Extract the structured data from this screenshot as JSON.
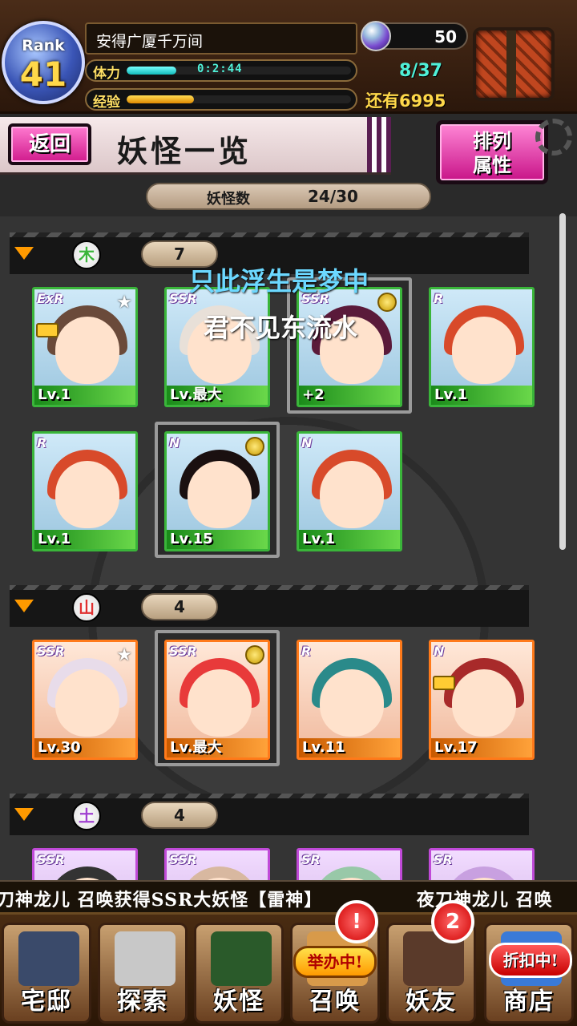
{
  "header": {
    "rank_label": "Rank",
    "rank_value": "41",
    "player_name": "安得广厦千万间",
    "stamina_label": "体力",
    "stamina_timer": "0:2:44",
    "stamina_fraction": 0.22,
    "exp_label": "经验",
    "exp_fraction": 0.3,
    "gems": "50",
    "box_count": "8/37",
    "remaining_label": "还有",
    "remaining_value": "6995"
  },
  "titlebar": {
    "back_label": "返回",
    "title": "妖怪一览",
    "sort_line1": "排列",
    "sort_line2": "属性"
  },
  "summary": {
    "label": "妖怪数",
    "value": "24/30"
  },
  "overlay": {
    "line1": "只此浮生是梦中",
    "line2": "君不见东流水"
  },
  "sections": [
    {
      "attribute": "木",
      "attribute_color": "#3ab53a",
      "count": "7",
      "cards": [
        {
          "rarity": "ExR",
          "level": "Lv.1",
          "star": true,
          "lock": true
        },
        {
          "rarity": "SSR",
          "level": "Lv.最大"
        },
        {
          "rarity": "SSR",
          "level": "+2",
          "medal": true
        },
        {
          "rarity": "R",
          "level": "Lv.1"
        },
        {
          "rarity": "R",
          "level": "Lv.1"
        },
        {
          "rarity": "N",
          "level": "Lv.15",
          "medal": true
        },
        {
          "rarity": "N",
          "level": "Lv.1"
        }
      ]
    },
    {
      "attribute": "山",
      "attribute_color": "#e03030",
      "count": "4",
      "cards": [
        {
          "rarity": "SSR",
          "level": "Lv.30",
          "star": true
        },
        {
          "rarity": "SSR",
          "level": "Lv.最大",
          "medal": true
        },
        {
          "rarity": "R",
          "level": "Lv.11"
        },
        {
          "rarity": "N",
          "level": "Lv.17",
          "lock": true
        }
      ]
    },
    {
      "attribute": "土",
      "attribute_color": "#a040d0",
      "count": "4",
      "cards": [
        {
          "rarity": "SSR"
        },
        {
          "rarity": "SSR"
        },
        {
          "rarity": "SR"
        },
        {
          "rarity": "SR"
        }
      ]
    }
  ],
  "ticker": {
    "text_a": "刀神龙儿 召唤获得SSR大妖怪【雷神】",
    "text_b": "夜刀神龙儿 召唤"
  },
  "nav": [
    {
      "label": "宅邸",
      "icon": "mansion-icon"
    },
    {
      "label": "探索",
      "icon": "magnifier-icon"
    },
    {
      "label": "妖怪",
      "icon": "scroll-icon"
    },
    {
      "label": "召唤",
      "icon": "summon-icon",
      "badge": "!",
      "tag": "举办中!"
    },
    {
      "label": "妖友",
      "icon": "friend-icon",
      "badge": "2"
    },
    {
      "label": "商店",
      "icon": "shop-icon",
      "tag": "折扣中!"
    }
  ],
  "colors": {
    "accent_pink": "#e0208c",
    "timer_cyan": "#4ff0d8",
    "gold": "#ffd84a",
    "wood_green": "#3ab53a",
    "fire_orange": "#ff7a1a"
  }
}
